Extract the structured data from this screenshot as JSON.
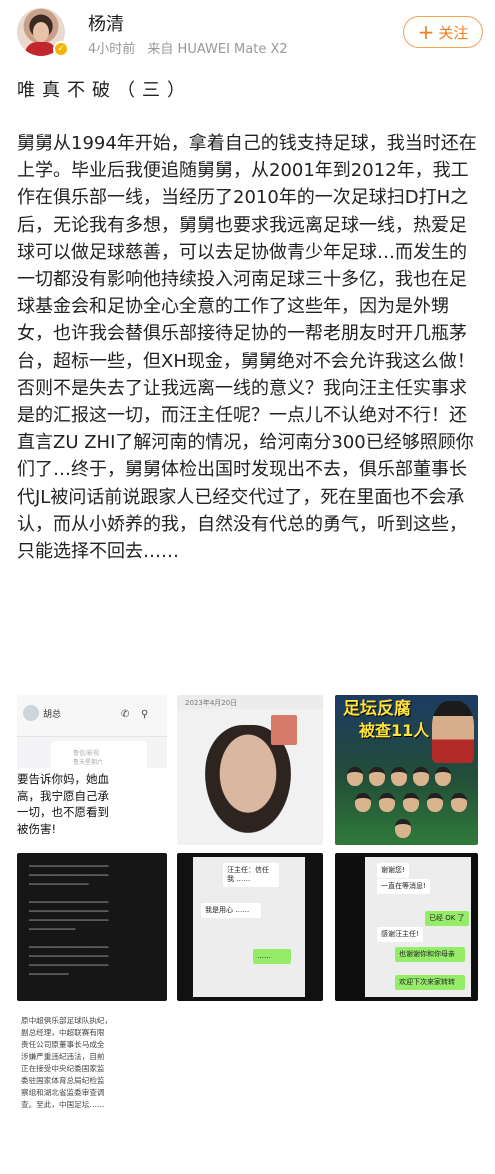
{
  "post": {
    "author": "杨清",
    "time": "4小时前",
    "source": "来自 HUAWEI Mate X2",
    "follow_label": "关注",
    "title": "唯真不破（三）",
    "body": "舅舅从1994年开始，拿着自己的钱支持足球，我当时还在上学。毕业后我便追随舅舅，从2001年到2012年，我工作在俱乐部一线，当经历了2010年的一次足球扫D打H之后，无论我有多想，舅舅也要求我远离足球一线，热爱足球可以做足球慈善，可以去足协做青少年足球…而发生的一切都没有影响他持续投入河南足球三十多亿，我也在足球基金会和足协全心全意的工作了这些年，因为是外甥女，也许我会替俱乐部接待足协的一帮老朋友时开几瓶茅台，超标一些，但XH现金，舅舅绝对不会允许我这么做！否则不是失去了让我远离一线的意义？我向汪主任实事求是的汇报这一切，而汪主任呢？一点儿不认绝对不行！还直言ZU ZHI了解河南的情况，给河南分300已经够照顾你们了…终于，舅舅体检出国时发现出不去，俱乐部董事长代JL被问话前说跟家人已经交代过了，死在里面也不会承认，而从小娇养的我，自然没有代总的勇气，听到这些，只能选择不回去……"
  },
  "images": {
    "img1": {
      "chat_name": "胡总",
      "card_lines": [
        "鲁信/影视",
        "鲁夭星期六"
      ],
      "message_lines": [
        "要告诉你妈，她血",
        "高，我宁愿自己承",
        "一切，也不愿看到",
        "被伤害!"
      ]
    },
    "img2": {
      "timestamp": "2023年4月20日"
    },
    "img3": {
      "poster_title": "足坛反腐",
      "poster_sub": "被查11人"
    },
    "img5": {
      "bubbles": [
        "汪主任：信任我 ……",
        "我是用心 ……",
        "……"
      ]
    },
    "img6": {
      "bubbles": [
        "谢谢您!",
        "一直在等消息!",
        "已经 OK 了",
        "感谢汪主任!",
        "也谢谢你和你母亲",
        "欢迎下次来家转转"
      ]
    },
    "img7": {
      "doc_lines": [
        "原中超俱乐部足球队执纪，",
        "副总经理，中超联赛有限",
        "责任公司原董事长马成全",
        "涉嫌严重违纪违法，目前",
        "正在接受中央纪委国家监",
        "委驻国家体育总局纪检监",
        "察组和湖北省监委审查调",
        "查。至此，中国足坛……"
      ]
    }
  },
  "icons": {
    "verified": "verified-badge-icon",
    "follow_plus": "plus-icon",
    "phone": "phone-icon",
    "profile": "profile-icon"
  },
  "colors": {
    "follow_accent": "#f07e1f",
    "verified": "#f6b200",
    "meta": "#999999"
  }
}
